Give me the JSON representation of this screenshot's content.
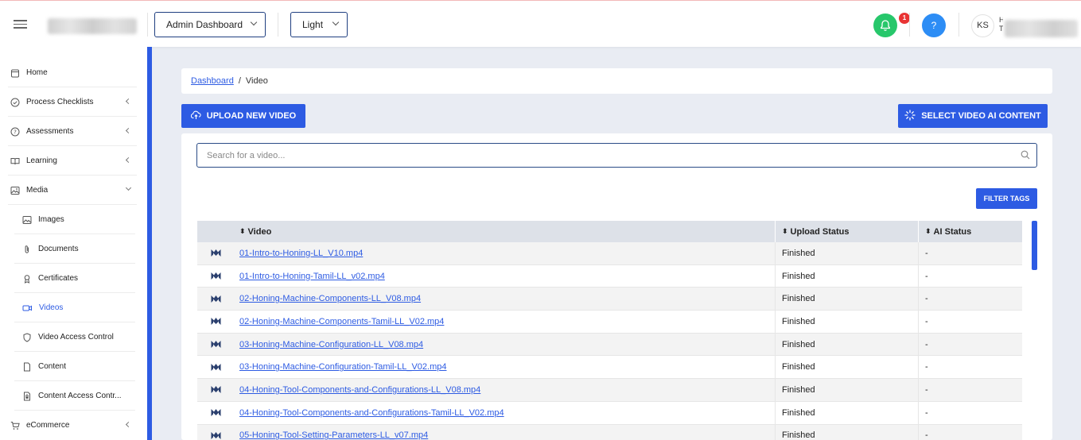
{
  "header": {
    "role_dropdown": "Admin Dashboard",
    "theme_dropdown": "Light",
    "notifications_count": "1",
    "help_label": "?",
    "user_initials": "KS",
    "user_name_fragment": "H T"
  },
  "sidebar": {
    "items": [
      {
        "label": "Home",
        "icon": "home-icon"
      },
      {
        "label": "Process Checklists",
        "icon": "check-circle-icon"
      },
      {
        "label": "Assessments",
        "icon": "question-circle-icon"
      },
      {
        "label": "Learning",
        "icon": "book-icon"
      },
      {
        "label": "Media",
        "icon": "image-icon"
      },
      {
        "label": "eCommerce",
        "icon": "cart-icon"
      }
    ],
    "media_sub": [
      {
        "label": "Images",
        "icon": "image-icon"
      },
      {
        "label": "Documents",
        "icon": "paperclip-icon"
      },
      {
        "label": "Certificates",
        "icon": "award-icon"
      },
      {
        "label": "Videos",
        "icon": "video-icon"
      },
      {
        "label": "Video Access Control",
        "icon": "shield-icon"
      },
      {
        "label": "Content",
        "icon": "file-icon"
      },
      {
        "label": "Content Access Contr...",
        "icon": "lock-file-icon"
      }
    ]
  },
  "breadcrumb": {
    "root": "Dashboard",
    "sep": "/",
    "current": "Video"
  },
  "actions": {
    "upload": "UPLOAD NEW VIDEO",
    "select_ai": "SELECT VIDEO AI CONTENT",
    "filter_tags": "FILTER TAGS"
  },
  "search": {
    "placeholder": "Search for a video..."
  },
  "table": {
    "headers": [
      "Video",
      "Upload Status",
      "AI Status"
    ],
    "sort_glyph": "⬍",
    "rows": [
      {
        "video": "01-Intro-to-Honing-LL_V10.mp4",
        "upload_status": "Finished",
        "ai_status": "-"
      },
      {
        "video": "01-Intro-to-Honing-Tamil-LL_v02.mp4",
        "upload_status": "Finished",
        "ai_status": "-"
      },
      {
        "video": "02-Honing-Machine-Components-LL_V08.mp4",
        "upload_status": "Finished",
        "ai_status": "-"
      },
      {
        "video": "02-Honing-Machine-Components-Tamil-LL_V02.mp4",
        "upload_status": "Finished",
        "ai_status": "-"
      },
      {
        "video": "03-Honing-Machine-Configuration-LL_V08.mp4",
        "upload_status": "Finished",
        "ai_status": "-"
      },
      {
        "video": "03-Honing-Machine-Configuration-Tamil-LL_V02.mp4",
        "upload_status": "Finished",
        "ai_status": "-"
      },
      {
        "video": "04-Honing-Tool-Components-and-Configurations-LL_V08.mp4",
        "upload_status": "Finished",
        "ai_status": "-"
      },
      {
        "video": "04-Honing-Tool-Components-and-Configurations-Tamil-LL_V02.mp4",
        "upload_status": "Finished",
        "ai_status": "-"
      },
      {
        "video": "05-Honing-Tool-Setting-Parameters-LL_v07.mp4",
        "upload_status": "Finished",
        "ai_status": "-"
      }
    ]
  },
  "colors": {
    "accent": "#2d5be3",
    "bell": "#27c76b",
    "help": "#2d8df5",
    "badge": "#e93434"
  }
}
